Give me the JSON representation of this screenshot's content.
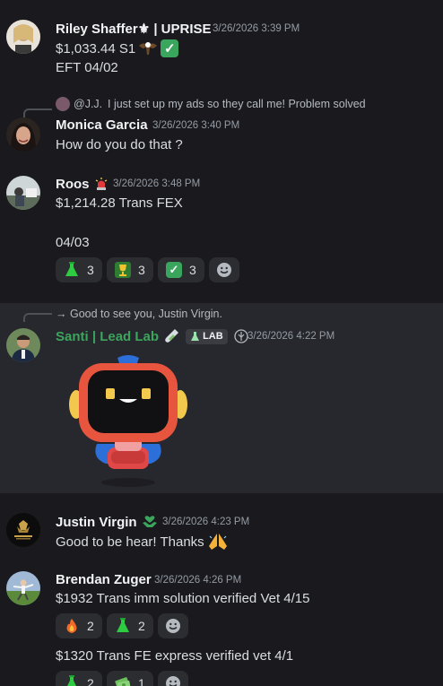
{
  "messages": {
    "riley": {
      "username": "Riley Shaffer⚜ | UPRISE",
      "timestamp": "3/26/2026 3:39 PM",
      "line1": "$1,033.44 S1",
      "line2": "EFT 04/02"
    },
    "monica": {
      "reply_author": "@J.J.",
      "reply_text": "I just set up my ads so they call me! Problem solved",
      "username": "Monica Garcia",
      "timestamp": "3/26/2026 3:40 PM",
      "line1": "How do you do that ?"
    },
    "roos": {
      "username": "Roos",
      "timestamp": "3/26/2026 3:48 PM",
      "line1": "$1,214.28 Trans FEX",
      "line2": "04/03",
      "reactions": [
        {
          "icon": "flask-icon",
          "count": "3"
        },
        {
          "icon": "trophy-icon",
          "count": "3"
        },
        {
          "icon": "check-icon",
          "count": "3"
        }
      ]
    },
    "santi": {
      "reply_text": "→ Good to see you, Justin Virgin.",
      "username": "Santi | Lead Lab",
      "tag": "LAB",
      "timestamp": "3/26/2026 4:22 PM",
      "name_color": "#3ba55c"
    },
    "justin": {
      "username": "Justin Virgin",
      "timestamp": "3/26/2026 4:23 PM",
      "line1": "Good to be hear! Thanks"
    },
    "brendan": {
      "username": "Brendan Zuger",
      "timestamp": "3/26/2026 4:26 PM",
      "line1": "$1932 Trans imm solution verified Vet 4/15",
      "reactions1": [
        {
          "icon": "fire-icon",
          "count": "2"
        },
        {
          "icon": "flask-icon",
          "count": "2"
        }
      ],
      "line2": "$1320 Trans FE express verified vet 4/1",
      "reactions2": [
        {
          "icon": "flask-icon",
          "count": "2"
        },
        {
          "icon": "money-icon",
          "count": "1"
        }
      ]
    }
  }
}
